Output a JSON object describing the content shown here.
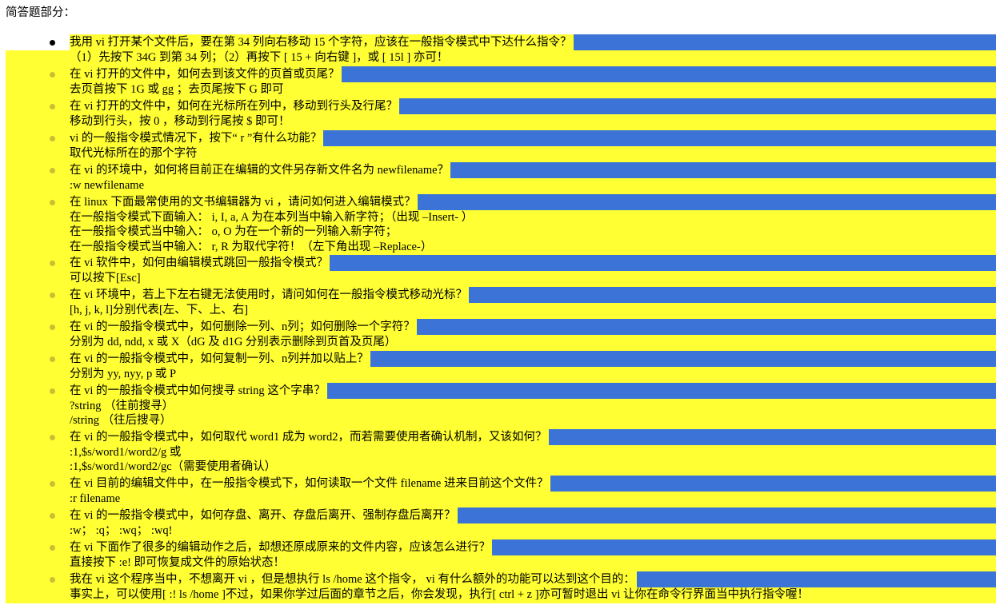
{
  "heading": "简答题部分：",
  "items": [
    {
      "q": "我用 vi 打开某个文件后，要在第 34 列向右移动 15 个字符，应该在一般指令模式中下达什么指令？",
      "a": [
        "（1）先按下 34G 到第 34 列；（2）再按下 [ 15 + 向右键 ]，或 [ 15l ] 亦可！"
      ]
    },
    {
      "q": "在 vi 打开的文件中，如何去到该文件的页首或页尾？",
      "a": [
        "去页首按下 1G 或 gg ；去页尾按下 G 即可"
      ]
    },
    {
      "q": "在 vi 打开的文件中，如何在光标所在列中，移动到行头及行尾？",
      "a": [
        "移动到行头，按 0 ，移动到行尾按 $ 即可！"
      ]
    },
    {
      "q": "vi 的一般指令模式情况下，按下“ r ”有什么功能？",
      "a": [
        "取代光标所在的那个字符"
      ]
    },
    {
      "q": "在 vi 的环境中，如何将目前正在编辑的文件另存新文件名为 newfilename？",
      "a": [
        ":w newfilename"
      ]
    },
    {
      "q": "在 linux 下面最常使用的文书编辑器为 vi ，请问如何进入编辑模式？",
      "a": [
        "在一般指令模式下面输入： i, I, a, A 为在本列当中输入新字符；（出现 –Insert- ）",
        "在一般指令模式当中输入： o, O 为在一个新的一列输入新字符；",
        "在一般指令模式当中输入： r, R 为取代字符！（左下角出现 –Replace-）"
      ]
    },
    {
      "q": "在 vi 软件中，如何由编辑模式跳回一般指令模式？",
      "a": [
        "可以按下[Esc]"
      ]
    },
    {
      "q": "在 vi 环境中，若上下左右键无法使用时，请问如何在一般指令模式移动光标？",
      "a": [
        "[h, j, k, l]分别代表[左、下、上、右]"
      ]
    },
    {
      "q": "在 vi 的一般指令模式中，如何删除一列、n列；如何删除一个字符？",
      "a": [
        "分别为 dd, ndd, x 或 X（dG 及 d1G 分别表示删除到页首及页尾）"
      ]
    },
    {
      "q": "在 vi 的一般指令模式中，如何复制一列、n列并加以贴上？",
      "a": [
        "分别为 yy, nyy, p 或 P"
      ]
    },
    {
      "q": "在 vi 的一般指令模式中如何搜寻 string 这个字串？",
      "a": [
        "?string （往前搜寻）",
        "/string （往后搜寻）"
      ]
    },
    {
      "q": "在 vi 的一般指令模式中，如何取代 word1 成为 word2，而若需要使用者确认机制，又该如何？",
      "a": [
        ":1,$s/word1/word2/g 或",
        ":1,$s/word1/word2/gc（需要使用者确认）"
      ]
    },
    {
      "q": "在 vi 目前的编辑文件中，在一般指令模式下，如何读取一个文件 filename 进来目前这个文件？",
      "a": [
        ":r filename"
      ]
    },
    {
      "q": "在 vi 的一般指令模式中，如何存盘、离开、存盘后离开、强制存盘后离开？",
      "a": [
        ":w； :q； :wq； :wq!"
      ]
    },
    {
      "q": "在 vi 下面作了很多的编辑动作之后，却想还原成原来的文件内容，应该怎么进行？",
      "a": [
        "直接按下 :e! 即可恢复成文件的原始状态！"
      ]
    },
    {
      "q": "我在 vi 这个程序当中，不想离开 vi ，但是想执行 ls /home 这个指令， vi 有什么额外的功能可以达到这个目的：",
      "a": [
        "事实上，可以使用[ :! ls /home ]不过，如果你学过后面的章节之后，你会发现，执行[ ctrl + z ]亦可暂时退出 vi 让你在命令行界面当中执行指令喔！"
      ]
    }
  ],
  "colors": {
    "highlight": "#ffff33",
    "selection": "#3b73d6"
  }
}
